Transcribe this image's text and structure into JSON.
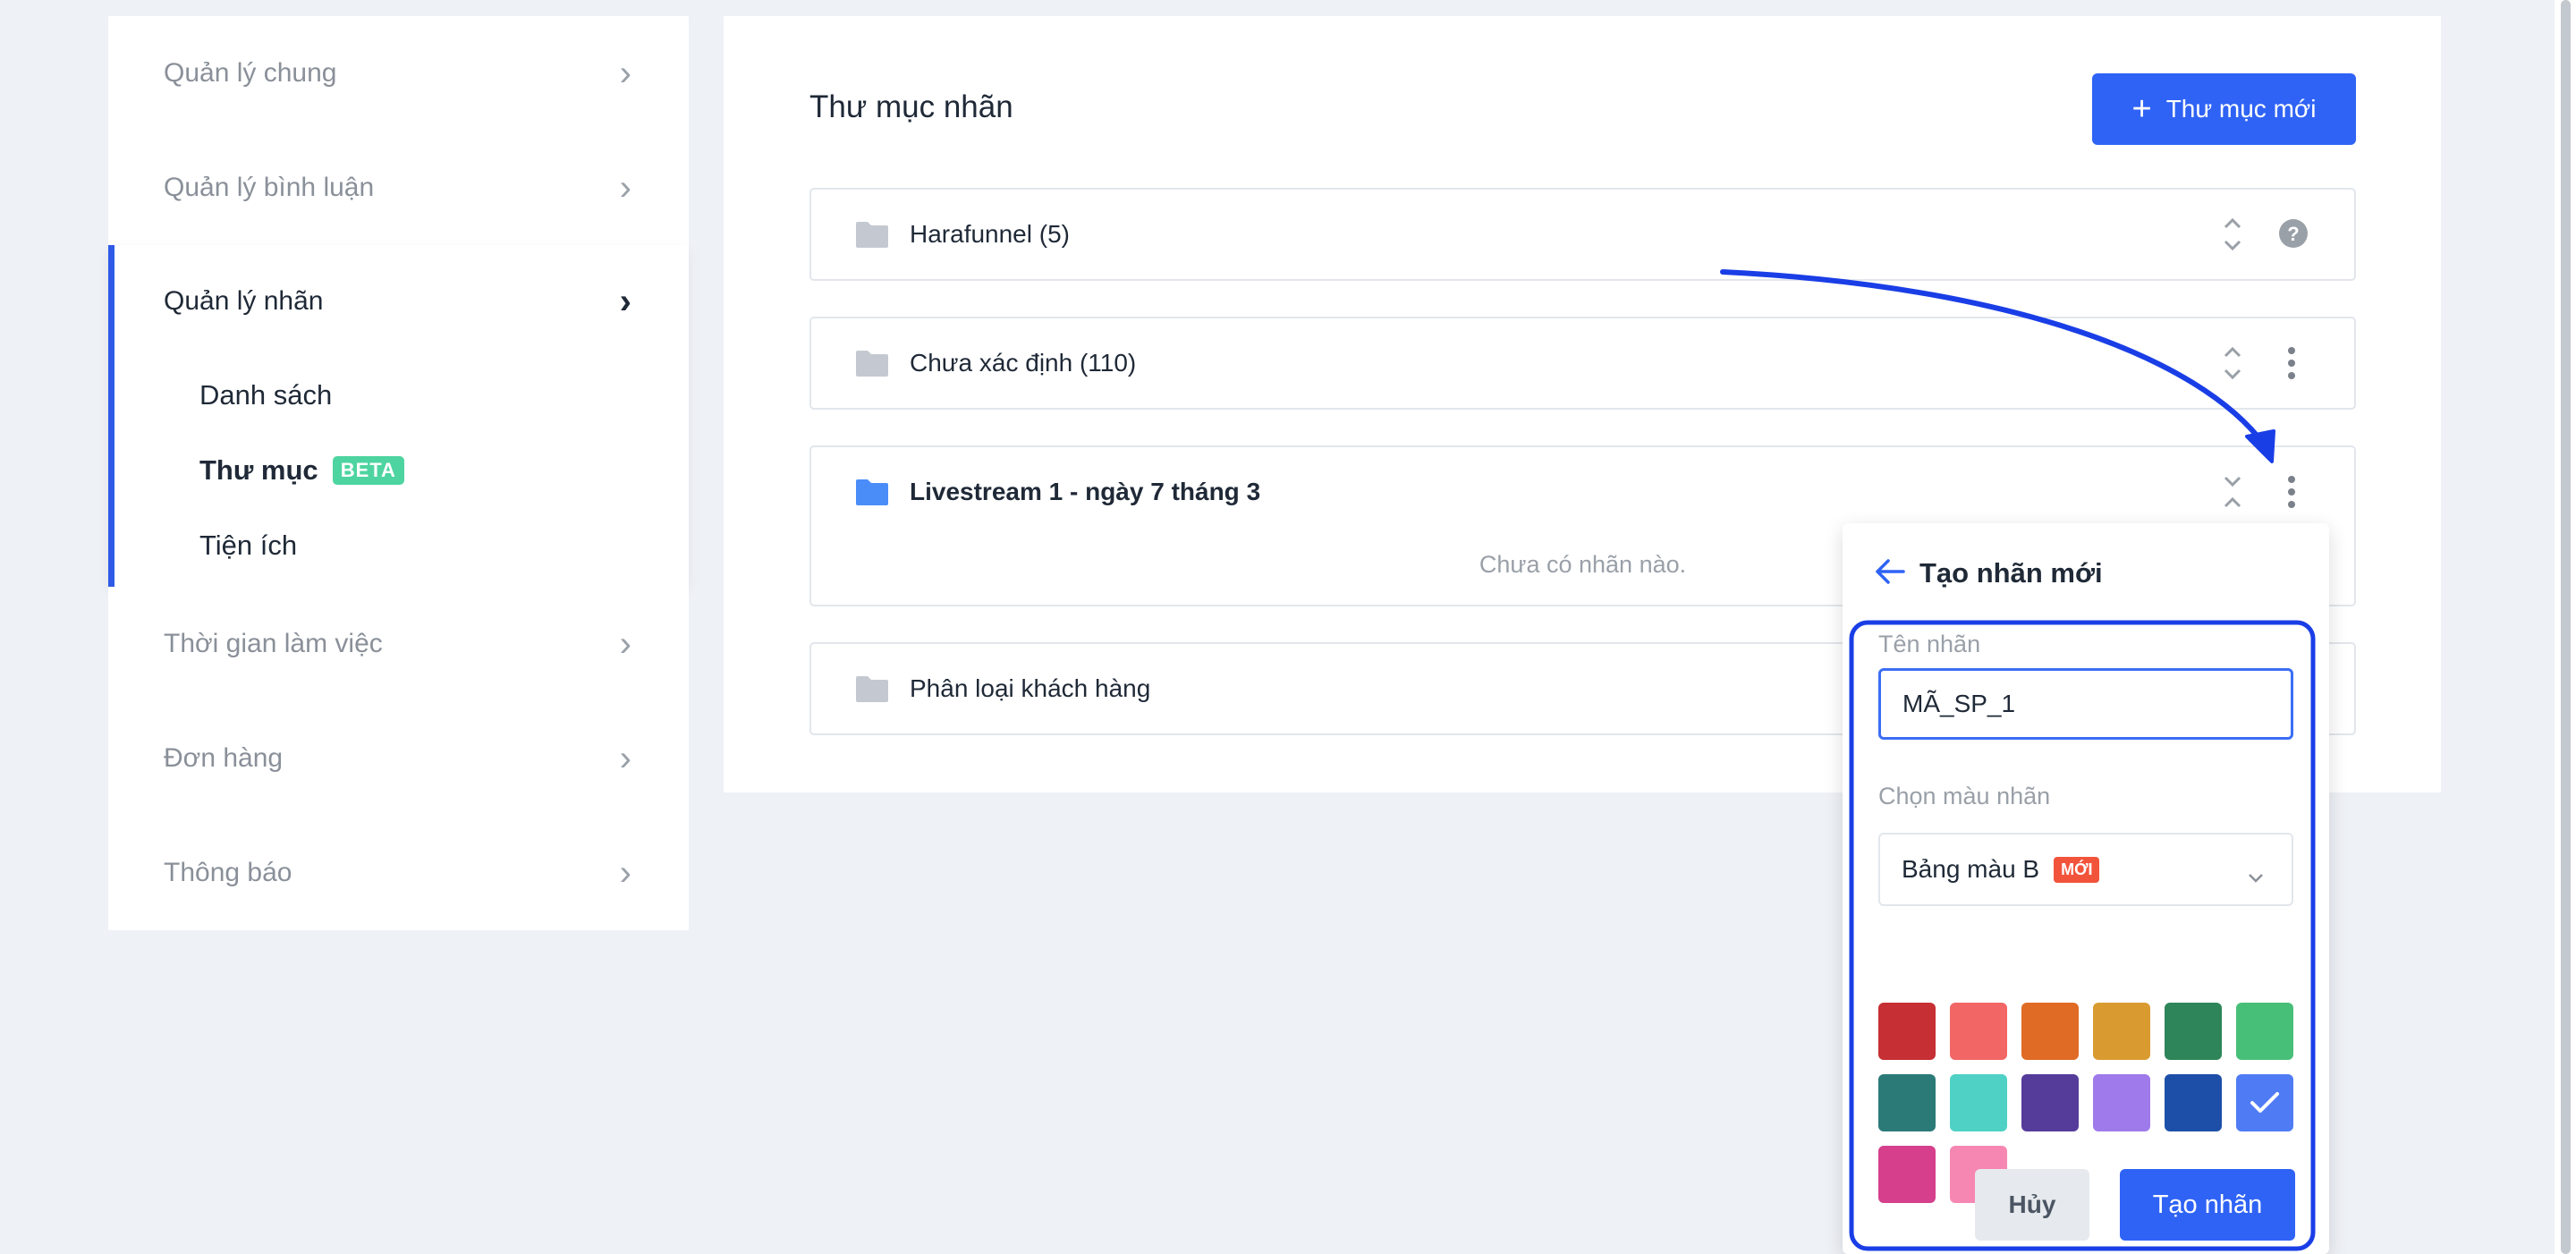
{
  "sidebar": {
    "items_top": [
      {
        "label": "Quản lý chung"
      },
      {
        "label": "Quản lý bình luận"
      }
    ],
    "active": {
      "label": "Quản lý nhãn",
      "sub_items": [
        {
          "label": "Danh sách"
        },
        {
          "label": "Thư mục",
          "badge": "BETA"
        },
        {
          "label": "Tiện ích"
        }
      ]
    },
    "items_bottom": [
      {
        "label": "Thời gian làm việc"
      },
      {
        "label": "Đơn hàng"
      },
      {
        "label": "Thông báo"
      }
    ]
  },
  "main": {
    "title": "Thư mục nhãn",
    "new_folder_label": "Thư mục mới",
    "folders": [
      {
        "name": "Harafunnel (5)"
      },
      {
        "name": "Chưa xác định (110)"
      },
      {
        "name": "Livestream 1 - ngày 7 tháng 3",
        "empty_text": "Chưa có nhãn nào."
      },
      {
        "name": "Phân loại khách hàng"
      }
    ]
  },
  "popover": {
    "title": "Tạo nhãn mới",
    "name_label": "Tên nhãn",
    "name_value": "MÃ_SP_1",
    "color_label": "Chọn màu nhãn",
    "palette_value": "Bảng màu B",
    "palette_badge": "MỚI",
    "swatches": [
      "#c62f33",
      "#f26665",
      "#e06b24",
      "#d99b30",
      "#2e8559",
      "#48bf78",
      "#2b7a78",
      "#4fd1c5",
      "#553c9a",
      "#9f7aea",
      "#1e4fa8",
      "#4f7cf5",
      "#d53f8c",
      "#f687b3"
    ],
    "selected_swatch_index": 11,
    "cancel_label": "Hủy",
    "create_label": "Tạo nhãn"
  },
  "colors": {
    "accent": "#2f63f5",
    "annotation": "#1a3ee6",
    "folder_gray": "#c4c9d1",
    "folder_blue": "#4b8df8"
  }
}
